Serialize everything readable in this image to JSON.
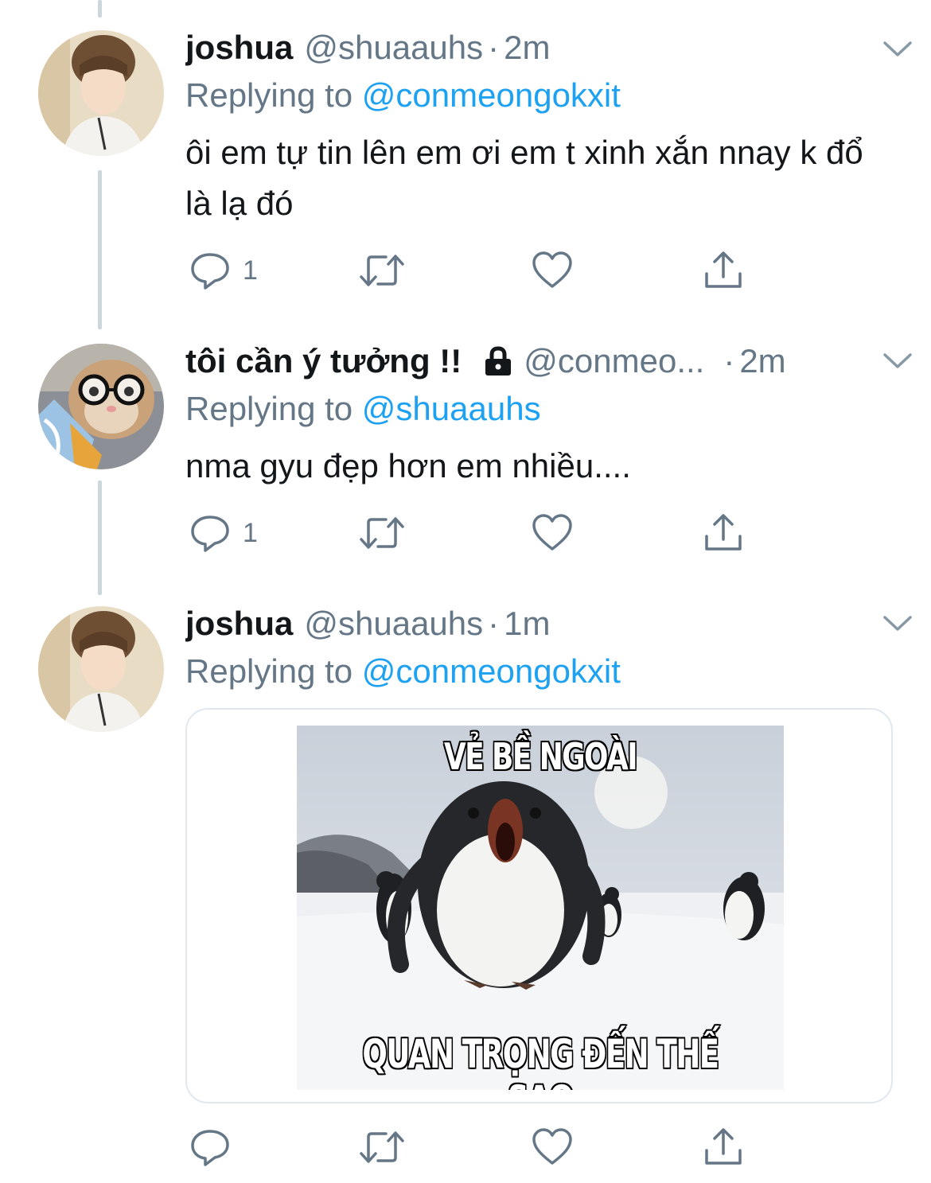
{
  "tweets": [
    {
      "display_name": "joshua",
      "handle": "@shuaauhs",
      "separator": "·",
      "time": "2m",
      "replying_prefix": "Replying to",
      "replying_to": "@conmeongokxit",
      "text": "ôi em tự tin lên em ơi em t xinh xắn nnay k đổ là lạ đó",
      "reply_count": "1"
    },
    {
      "display_name": "tôi cần ý tưởng !!",
      "protected_icon": "lock-icon",
      "handle": "@conmeo...",
      "separator": "·",
      "time": "2m",
      "replying_prefix": "Replying to",
      "replying_to": "@shuaauhs",
      "text": "nma gyu đẹp hơn em nhiều....",
      "reply_count": "1"
    },
    {
      "display_name": "joshua",
      "handle": "@shuaauhs",
      "separator": "·",
      "time": "1m",
      "replying_prefix": "Replying to",
      "replying_to": "@conmeongokxit",
      "media": {
        "caption_top": "VẺ BỀ NGOÀI",
        "caption_bottom": "QUAN TRỌNG ĐẾN THẾ SAO"
      }
    }
  ],
  "icons": {
    "reply": "reply-icon",
    "retweet": "retweet-icon",
    "like": "heart-icon",
    "share": "share-icon",
    "menu": "chevron-down-icon"
  },
  "colors": {
    "link": "#1da1f2",
    "secondary_text": "#657786",
    "thread_line": "#ccd6dd",
    "icon": "#657786"
  }
}
